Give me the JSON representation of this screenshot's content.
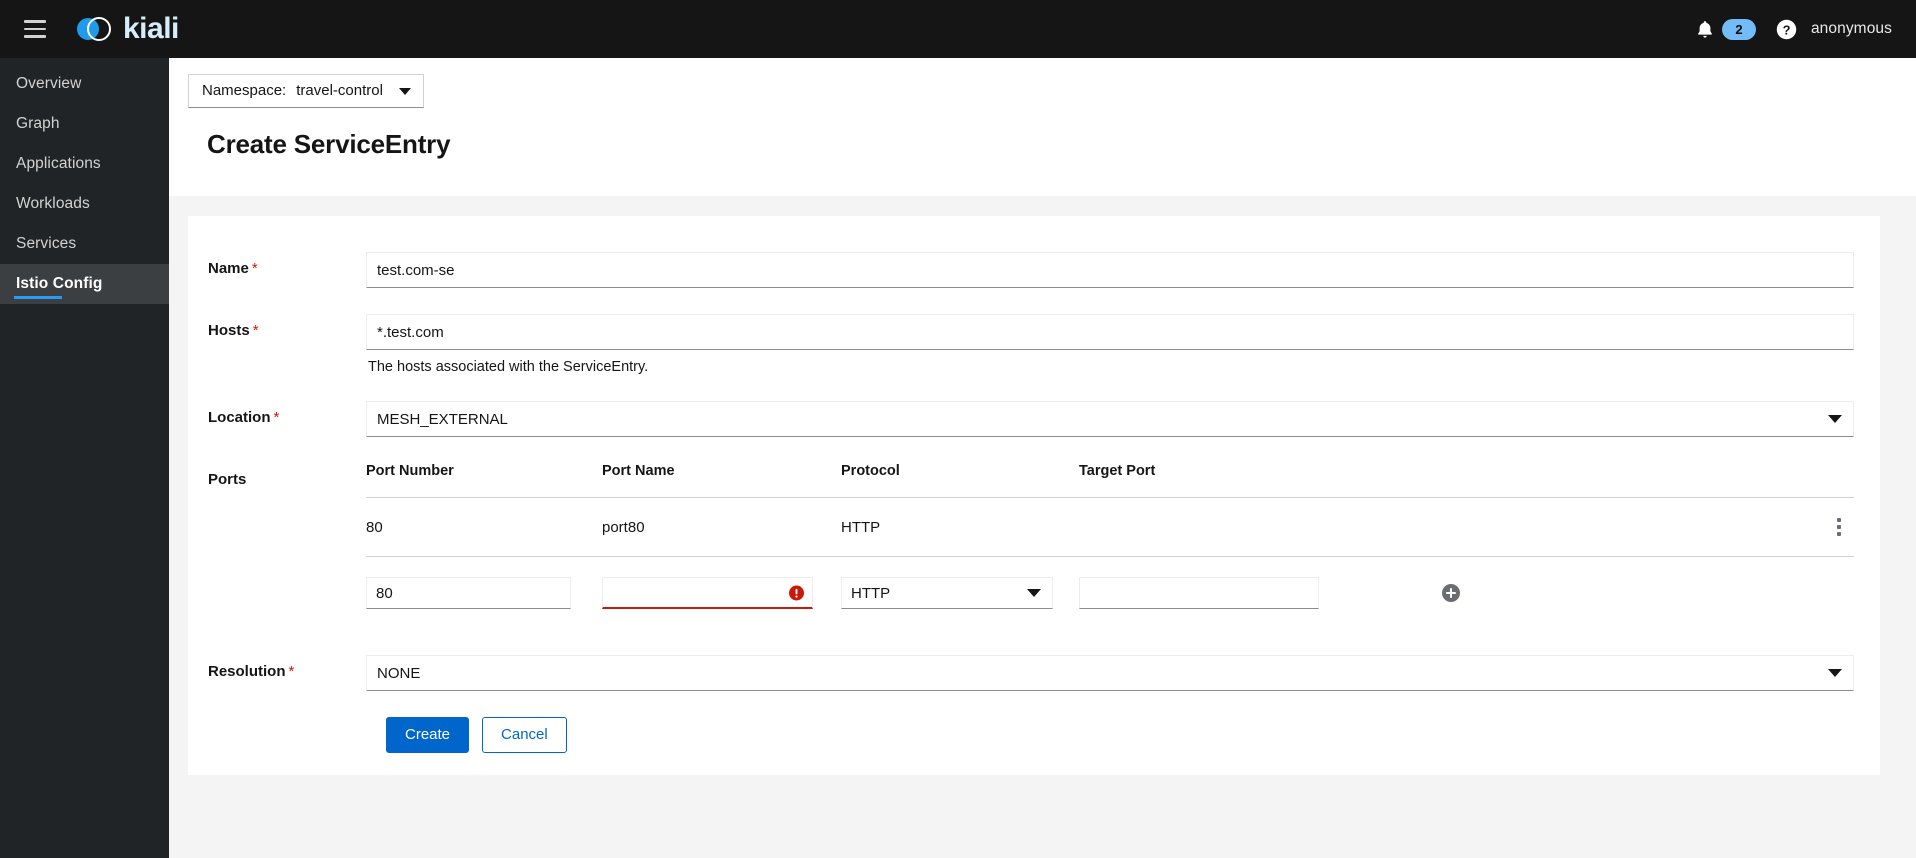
{
  "masthead": {
    "menu_toggle_name": "Global navigation",
    "brand_name": "kiali",
    "notifications_count": "2",
    "user": "anonymous"
  },
  "sidebar": {
    "items": [
      {
        "label": "Overview",
        "active": false
      },
      {
        "label": "Graph",
        "active": false
      },
      {
        "label": "Applications",
        "active": false
      },
      {
        "label": "Workloads",
        "active": false
      },
      {
        "label": "Services",
        "active": false
      },
      {
        "label": "Istio Config",
        "active": true
      }
    ]
  },
  "namespace_selector": {
    "label": "Namespace:",
    "value": "travel-control"
  },
  "page": {
    "title": "Create ServiceEntry"
  },
  "form": {
    "name": {
      "label": "Name",
      "required": "*",
      "value": "test.com-se"
    },
    "hosts": {
      "label": "Hosts",
      "required": "*",
      "value": "*.test.com",
      "helper_text": "The hosts associated with the ServiceEntry."
    },
    "location": {
      "label": "Location",
      "required": "*",
      "value": "MESH_EXTERNAL"
    },
    "ports": {
      "label": "Ports",
      "columns": [
        "Port Number",
        "Port Name",
        "Protocol",
        "Target Port"
      ],
      "rows": [
        {
          "port_number": "80",
          "port_name": "port80",
          "protocol": "HTTP",
          "target_port": ""
        }
      ],
      "new_row": {
        "port_number": "80",
        "port_name": "",
        "port_name_invalid": true,
        "protocol": "HTTP",
        "target_port": ""
      }
    },
    "resolution": {
      "label": "Resolution",
      "required": "*",
      "value": "NONE"
    }
  },
  "actions": {
    "create_label": "Create",
    "cancel_label": "Cancel"
  },
  "colors": {
    "accent_blue": "#0066cc",
    "brand_blue": "#2b9af3",
    "error_red": "#c9190b",
    "masthead_bg": "#151515",
    "sidebar_bg": "#212427",
    "page_bg": "#f4f4f4"
  }
}
